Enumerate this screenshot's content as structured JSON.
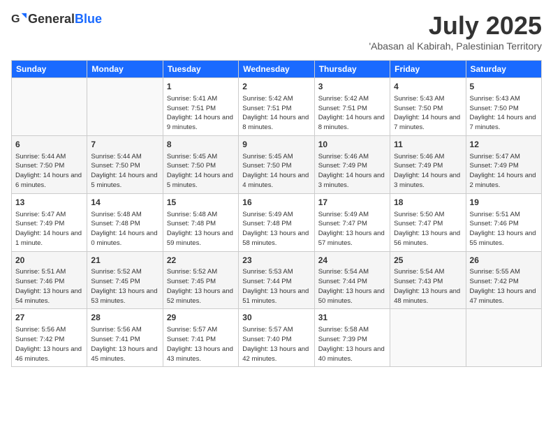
{
  "header": {
    "logo_general": "General",
    "logo_blue": "Blue",
    "month": "July 2025",
    "location": "'Abasan al Kabirah, Palestinian Territory"
  },
  "weekdays": [
    "Sunday",
    "Monday",
    "Tuesday",
    "Wednesday",
    "Thursday",
    "Friday",
    "Saturday"
  ],
  "weeks": [
    [
      {
        "day": "",
        "info": ""
      },
      {
        "day": "",
        "info": ""
      },
      {
        "day": "1",
        "info": "Sunrise: 5:41 AM\nSunset: 7:51 PM\nDaylight: 14 hours and 9 minutes."
      },
      {
        "day": "2",
        "info": "Sunrise: 5:42 AM\nSunset: 7:51 PM\nDaylight: 14 hours and 8 minutes."
      },
      {
        "day": "3",
        "info": "Sunrise: 5:42 AM\nSunset: 7:51 PM\nDaylight: 14 hours and 8 minutes."
      },
      {
        "day": "4",
        "info": "Sunrise: 5:43 AM\nSunset: 7:50 PM\nDaylight: 14 hours and 7 minutes."
      },
      {
        "day": "5",
        "info": "Sunrise: 5:43 AM\nSunset: 7:50 PM\nDaylight: 14 hours and 7 minutes."
      }
    ],
    [
      {
        "day": "6",
        "info": "Sunrise: 5:44 AM\nSunset: 7:50 PM\nDaylight: 14 hours and 6 minutes."
      },
      {
        "day": "7",
        "info": "Sunrise: 5:44 AM\nSunset: 7:50 PM\nDaylight: 14 hours and 5 minutes."
      },
      {
        "day": "8",
        "info": "Sunrise: 5:45 AM\nSunset: 7:50 PM\nDaylight: 14 hours and 5 minutes."
      },
      {
        "day": "9",
        "info": "Sunrise: 5:45 AM\nSunset: 7:50 PM\nDaylight: 14 hours and 4 minutes."
      },
      {
        "day": "10",
        "info": "Sunrise: 5:46 AM\nSunset: 7:49 PM\nDaylight: 14 hours and 3 minutes."
      },
      {
        "day": "11",
        "info": "Sunrise: 5:46 AM\nSunset: 7:49 PM\nDaylight: 14 hours and 3 minutes."
      },
      {
        "day": "12",
        "info": "Sunrise: 5:47 AM\nSunset: 7:49 PM\nDaylight: 14 hours and 2 minutes."
      }
    ],
    [
      {
        "day": "13",
        "info": "Sunrise: 5:47 AM\nSunset: 7:49 PM\nDaylight: 14 hours and 1 minute."
      },
      {
        "day": "14",
        "info": "Sunrise: 5:48 AM\nSunset: 7:48 PM\nDaylight: 14 hours and 0 minutes."
      },
      {
        "day": "15",
        "info": "Sunrise: 5:48 AM\nSunset: 7:48 PM\nDaylight: 13 hours and 59 minutes."
      },
      {
        "day": "16",
        "info": "Sunrise: 5:49 AM\nSunset: 7:48 PM\nDaylight: 13 hours and 58 minutes."
      },
      {
        "day": "17",
        "info": "Sunrise: 5:49 AM\nSunset: 7:47 PM\nDaylight: 13 hours and 57 minutes."
      },
      {
        "day": "18",
        "info": "Sunrise: 5:50 AM\nSunset: 7:47 PM\nDaylight: 13 hours and 56 minutes."
      },
      {
        "day": "19",
        "info": "Sunrise: 5:51 AM\nSunset: 7:46 PM\nDaylight: 13 hours and 55 minutes."
      }
    ],
    [
      {
        "day": "20",
        "info": "Sunrise: 5:51 AM\nSunset: 7:46 PM\nDaylight: 13 hours and 54 minutes."
      },
      {
        "day": "21",
        "info": "Sunrise: 5:52 AM\nSunset: 7:45 PM\nDaylight: 13 hours and 53 minutes."
      },
      {
        "day": "22",
        "info": "Sunrise: 5:52 AM\nSunset: 7:45 PM\nDaylight: 13 hours and 52 minutes."
      },
      {
        "day": "23",
        "info": "Sunrise: 5:53 AM\nSunset: 7:44 PM\nDaylight: 13 hours and 51 minutes."
      },
      {
        "day": "24",
        "info": "Sunrise: 5:54 AM\nSunset: 7:44 PM\nDaylight: 13 hours and 50 minutes."
      },
      {
        "day": "25",
        "info": "Sunrise: 5:54 AM\nSunset: 7:43 PM\nDaylight: 13 hours and 48 minutes."
      },
      {
        "day": "26",
        "info": "Sunrise: 5:55 AM\nSunset: 7:42 PM\nDaylight: 13 hours and 47 minutes."
      }
    ],
    [
      {
        "day": "27",
        "info": "Sunrise: 5:56 AM\nSunset: 7:42 PM\nDaylight: 13 hours and 46 minutes."
      },
      {
        "day": "28",
        "info": "Sunrise: 5:56 AM\nSunset: 7:41 PM\nDaylight: 13 hours and 45 minutes."
      },
      {
        "day": "29",
        "info": "Sunrise: 5:57 AM\nSunset: 7:41 PM\nDaylight: 13 hours and 43 minutes."
      },
      {
        "day": "30",
        "info": "Sunrise: 5:57 AM\nSunset: 7:40 PM\nDaylight: 13 hours and 42 minutes."
      },
      {
        "day": "31",
        "info": "Sunrise: 5:58 AM\nSunset: 7:39 PM\nDaylight: 13 hours and 40 minutes."
      },
      {
        "day": "",
        "info": ""
      },
      {
        "day": "",
        "info": ""
      }
    ]
  ]
}
